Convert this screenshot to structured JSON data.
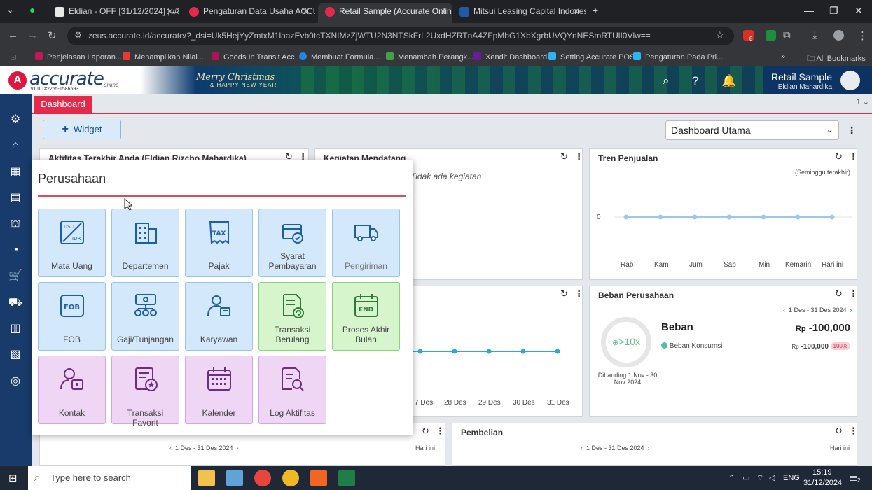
{
  "browser": {
    "tabs": [
      {
        "title": "Eldian - OFF [31/12/2024] | #8",
        "active": false
      },
      {
        "title": "Pengaturan Data Usaha ACCUR",
        "active": false
      },
      {
        "title": "Retail Sample (Accurate Online)",
        "active": true
      },
      {
        "title": "Mitsui Leasing Capital Indonesi",
        "active": false
      }
    ],
    "url": "zeus.accurate.id/accurate/?_dsi=Uk5HejYyZmtxM1laazEvb0tcTXNIMzZjWTU2N3NTSkFrL2UxdHZRTnA4ZFpMbG1XbXgrbUVQYnNESmRTUlI0Vlw==",
    "bookmarks": [
      "Penjelasan Laporan...",
      "Menampilkan Nilai...",
      "Goods In Transit Acc...",
      "Membuat Formula...",
      "Menambah Perangk...",
      "Xendit Dashboard",
      "Setting Accurate POS",
      "Pengaturan Pada Pri..."
    ],
    "all_bookmarks": "All Bookmarks",
    "extension_badge": "8"
  },
  "app": {
    "logo": "accurate",
    "logo_online": "online",
    "version": "v1.0.1#2255-1586593",
    "greeting": "Merry Christmas",
    "greeting_sub": "& HAPPY NEW YEAR",
    "company": "Retail Sample",
    "user": "Eldian Mahardika"
  },
  "dashboard": {
    "tab_label": "Dashboard",
    "page_num": "1",
    "widget_button": "Widget",
    "selected_dashboard": "Dashboard Utama",
    "cards": {
      "aktivitas_title": "Aktifitas Terakhir Anda (Eldian Rizcho Mahardika)",
      "kegiatan_title": "Kegiatan Mendatang",
      "kegiatan_empty": "Tidak ada kegiatan",
      "tren_title": "Tren Penjualan",
      "tren_period": "(Seminggu terakhir)",
      "tren_zero": "0",
      "tren_days": [
        "Rab",
        "Kam",
        "Jum",
        "Sab",
        "Min",
        "Kemarin",
        "Hari ini"
      ],
      "mid_dates": [
        "7 Des",
        "28 Des",
        "29 Des",
        "30 Des",
        "31 Des"
      ],
      "beban_title": "Beban Perusahaan",
      "beban_period": "1 Des - 31 Des 2024",
      "beban_label": "Beban",
      "beban_currency": "Rp",
      "beban_total": "-100,000",
      "beban_ratio": ">10x",
      "beban_compare": "Dibanding 1 Nov - 30 Nov 2024",
      "beban_item": "Beban Konsumsi",
      "beban_item_value": "-100,000",
      "beban_item_pct": "100%",
      "left_bottom_period": "1 Des - 31 Des 2024",
      "left_bottom_today": "Hari ini",
      "pembelian_title": "Pembelian",
      "pembelian_period": "1 Des - 31 Des 2024",
      "pembelian_today": "Hari ini"
    }
  },
  "popup": {
    "title": "Perusahaan",
    "tiles": [
      {
        "label": "Mata Uang",
        "color": "blue",
        "icon": "currency-icon"
      },
      {
        "label": "Departemen",
        "color": "blue",
        "icon": "building-icon"
      },
      {
        "label": "Pajak",
        "color": "blue",
        "icon": "tax-icon"
      },
      {
        "label": "Syarat Pembayaran",
        "color": "blue",
        "icon": "payment-terms-icon"
      },
      {
        "label": "Pengiriman",
        "color": "blue",
        "icon": "truck-icon"
      },
      {
        "label": "FOB",
        "color": "blue",
        "icon": "fob-icon"
      },
      {
        "label": "Gaji/Tunjangan",
        "color": "blue",
        "icon": "salary-icon"
      },
      {
        "label": "Karyawan",
        "color": "blue",
        "icon": "employee-icon"
      },
      {
        "label": "Transaksi Berulang",
        "color": "green",
        "icon": "recurring-icon"
      },
      {
        "label": "Proses Akhir Bulan",
        "color": "green",
        "icon": "end-month-icon"
      },
      {
        "label": "Kontak",
        "color": "purple",
        "icon": "contact-icon"
      },
      {
        "label": "Transaksi Favorit",
        "color": "purple",
        "icon": "favorite-icon"
      },
      {
        "label": "Kalender",
        "color": "purple",
        "icon": "calendar-icon"
      },
      {
        "label": "Log Aktifitas",
        "color": "purple",
        "icon": "log-icon"
      }
    ]
  },
  "taskbar": {
    "search_placeholder": "Type here to search",
    "lang": "ENG",
    "time": "15:19",
    "date": "31/12/2024",
    "notif_count": "2"
  }
}
